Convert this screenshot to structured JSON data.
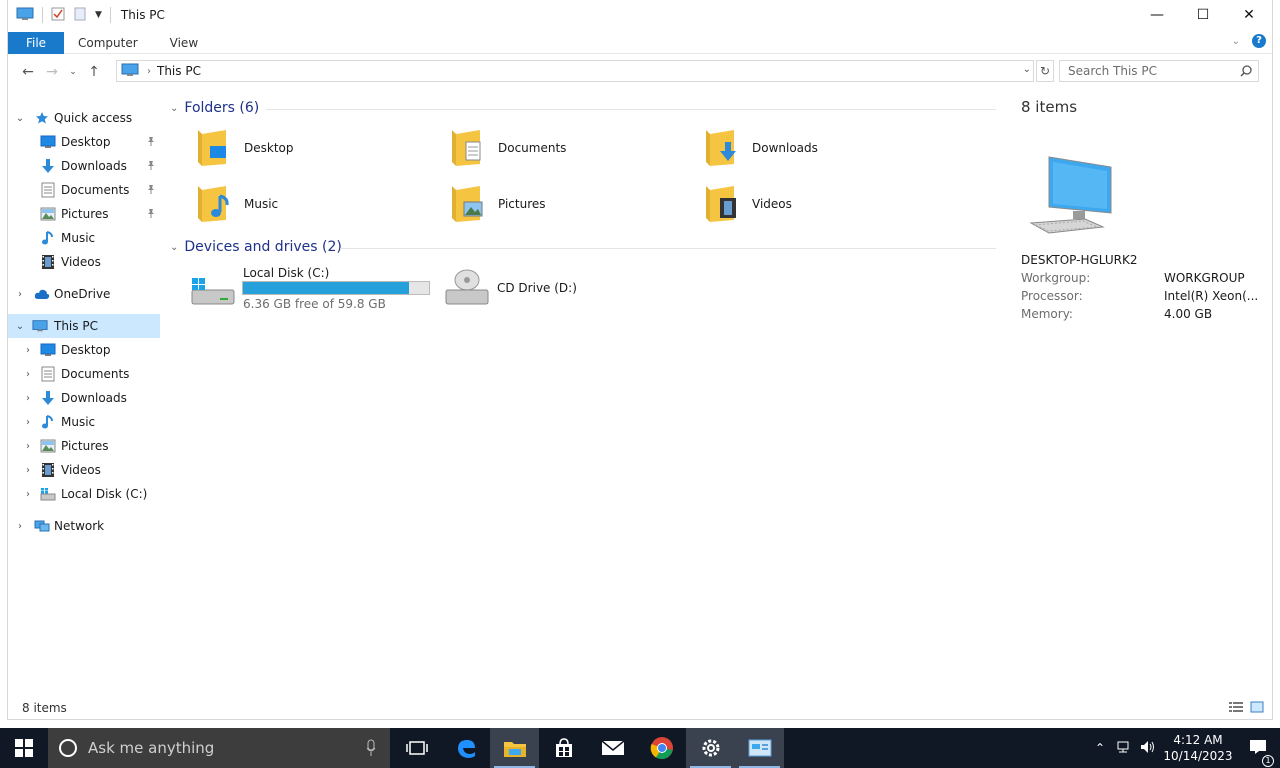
{
  "window": {
    "title": "This PC",
    "controls": {
      "minimize": "—",
      "maximize": "☐",
      "close": "✕"
    }
  },
  "ribbon": {
    "tabs": [
      "File",
      "Computer",
      "View"
    ]
  },
  "address": {
    "crumb": "This PC",
    "search_placeholder": "Search This PC"
  },
  "nav": {
    "quick_access": "Quick access",
    "quick_items": [
      {
        "label": "Desktop",
        "icon": "desktop-icon"
      },
      {
        "label": "Downloads",
        "icon": "downloads-icon"
      },
      {
        "label": "Documents",
        "icon": "documents-icon"
      },
      {
        "label": "Pictures",
        "icon": "pictures-icon"
      },
      {
        "label": "Music",
        "icon": "music-icon"
      },
      {
        "label": "Videos",
        "icon": "videos-icon"
      }
    ],
    "onedrive": "OneDrive",
    "this_pc": "This PC",
    "pc_items": [
      {
        "label": "Desktop",
        "icon": "desktop-icon"
      },
      {
        "label": "Documents",
        "icon": "documents-icon"
      },
      {
        "label": "Downloads",
        "icon": "downloads-icon"
      },
      {
        "label": "Music",
        "icon": "music-icon"
      },
      {
        "label": "Pictures",
        "icon": "pictures-icon"
      },
      {
        "label": "Videos",
        "icon": "videos-icon"
      },
      {
        "label": "Local Disk (C:)",
        "icon": "drive-icon"
      }
    ],
    "network": "Network"
  },
  "content": {
    "folders_header": "Folders (6)",
    "folders": [
      "Desktop",
      "Documents",
      "Downloads",
      "Music",
      "Pictures",
      "Videos"
    ],
    "devices_header": "Devices and drives (2)",
    "drives": {
      "c_name": "Local Disk (C:)",
      "c_free": "6.36 GB free of 59.8 GB",
      "c_used_fraction": 0.894,
      "d_name": "CD Drive (D:)"
    }
  },
  "details": {
    "count": "8 items",
    "pc_name": "DESKTOP-HGLURK2",
    "props": [
      {
        "key": "Workgroup:",
        "value": "WORKGROUP"
      },
      {
        "key": "Processor:",
        "value": "Intel(R) Xeon(..."
      },
      {
        "key": "Memory:",
        "value": "4.00 GB"
      }
    ]
  },
  "status": {
    "count": "8 items"
  },
  "taskbar": {
    "search_placeholder": "Ask me anything",
    "time": "4:12 AM",
    "date": "10/14/2023",
    "notification_count": "1"
  },
  "colors": {
    "accent": "#1979ca",
    "selection": "#cce8ff",
    "drive_bar": "#26a0da",
    "folder": "#f5c542",
    "header_text": "#1e3287"
  }
}
